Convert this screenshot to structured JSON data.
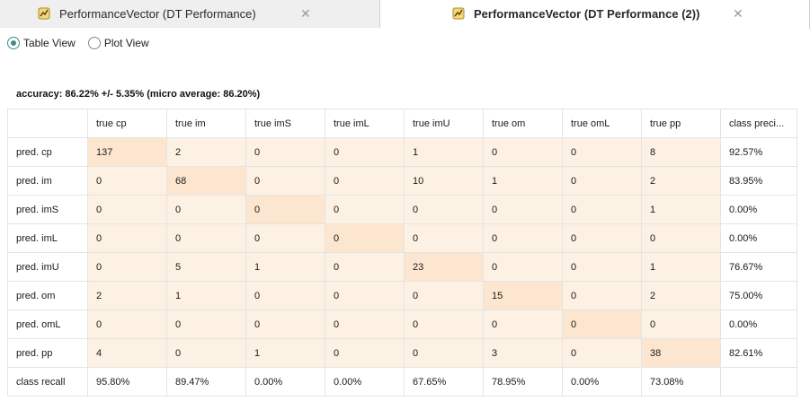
{
  "tabs": [
    {
      "label": "PerformanceVector (DT Performance)",
      "icon": "performance-vector-icon",
      "active": false
    },
    {
      "label": "PerformanceVector (DT Performance (2))",
      "icon": "performance-vector-icon",
      "active": true
    }
  ],
  "views": {
    "table": "Table View",
    "plot": "Plot View",
    "selected": "Table View"
  },
  "accuracy": "accuracy: 86.22% +/- 5.35% (micro average: 86.20%)",
  "matrix": {
    "headers": [
      "",
      "true cp",
      "true im",
      "true imS",
      "true imL",
      "true imU",
      "true om",
      "true omL",
      "true pp",
      "class preci..."
    ],
    "rows": [
      {
        "label": "pred. cp",
        "cells": [
          "137",
          "2",
          "0",
          "0",
          "1",
          "0",
          "0",
          "8"
        ],
        "precision": "92.57%"
      },
      {
        "label": "pred. im",
        "cells": [
          "0",
          "68",
          "0",
          "0",
          "10",
          "1",
          "0",
          "2"
        ],
        "precision": "83.95%"
      },
      {
        "label": "pred. imS",
        "cells": [
          "0",
          "0",
          "0",
          "0",
          "0",
          "0",
          "0",
          "1"
        ],
        "precision": "0.00%"
      },
      {
        "label": "pred. imL",
        "cells": [
          "0",
          "0",
          "0",
          "0",
          "0",
          "0",
          "0",
          "0"
        ],
        "precision": "0.00%"
      },
      {
        "label": "pred. imU",
        "cells": [
          "0",
          "5",
          "1",
          "0",
          "23",
          "0",
          "0",
          "1"
        ],
        "precision": "76.67%"
      },
      {
        "label": "pred. om",
        "cells": [
          "2",
          "1",
          "0",
          "0",
          "0",
          "15",
          "0",
          "2"
        ],
        "precision": "75.00%"
      },
      {
        "label": "pred. omL",
        "cells": [
          "0",
          "0",
          "0",
          "0",
          "0",
          "0",
          "0",
          "0"
        ],
        "precision": "0.00%"
      },
      {
        "label": "pred. pp",
        "cells": [
          "4",
          "0",
          "1",
          "0",
          "0",
          "3",
          "0",
          "38"
        ],
        "precision": "82.61%"
      }
    ],
    "recall": {
      "label": "class recall",
      "values": [
        "95.80%",
        "89.47%",
        "0.00%",
        "0.00%",
        "67.65%",
        "78.95%",
        "0.00%",
        "73.08%"
      ],
      "last": ""
    }
  },
  "colors": {
    "accent": "#3d8c8c",
    "cell": "#fdf1e3",
    "diagonal": "#fde6cf"
  }
}
